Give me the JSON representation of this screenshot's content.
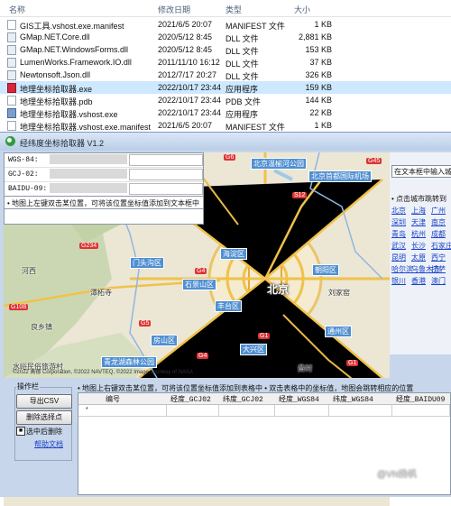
{
  "explorer": {
    "columns": {
      "name": "名称",
      "date": "修改日期",
      "type": "类型",
      "size": "大小"
    },
    "files": [
      {
        "name": "GIS工具.vshost.exe.manifest",
        "date": "2021/6/5 20:07",
        "type": "MANIFEST 文件",
        "size": "1 KB",
        "icon": "doc",
        "selected": false
      },
      {
        "name": "GMap.NET.Core.dll",
        "date": "2020/5/12 8:45",
        "type": "DLL 文件",
        "size": "2,881 KB",
        "icon": "dll",
        "selected": false
      },
      {
        "name": "GMap.NET.WindowsForms.dll",
        "date": "2020/5/12 8:45",
        "type": "DLL 文件",
        "size": "153 KB",
        "icon": "dll",
        "selected": false
      },
      {
        "name": "LumenWorks.Framework.IO.dll",
        "date": "2011/11/10 16:12",
        "type": "DLL 文件",
        "size": "37 KB",
        "icon": "dll",
        "selected": false
      },
      {
        "name": "Newtonsoft.Json.dll",
        "date": "2012/7/17 20:27",
        "type": "DLL 文件",
        "size": "326 KB",
        "icon": "dll",
        "selected": false
      },
      {
        "name": "地理坐标拾取器.exe",
        "date": "2022/10/17 23:44",
        "type": "应用程序",
        "size": "159 KB",
        "icon": "exe",
        "selected": true
      },
      {
        "name": "地理坐标拾取器.pdb",
        "date": "2022/10/17 23:44",
        "type": "PDB 文件",
        "size": "144 KB",
        "icon": "doc",
        "selected": false
      },
      {
        "name": "地理坐标拾取器.vshost.exe",
        "date": "2022/10/17 23:44",
        "type": "应用程序",
        "size": "22 KB",
        "icon": "exe2",
        "selected": false
      },
      {
        "name": "地理坐标拾取器.vshost.exe.manifest",
        "date": "2021/6/5 20:07",
        "type": "MANIFEST 文件",
        "size": "1 KB",
        "icon": "doc",
        "selected": false
      }
    ]
  },
  "app": {
    "title": "经纬度坐标拾取器 V1.2",
    "coords": [
      {
        "label": "WGS-84:"
      },
      {
        "label": "GCJ-02:"
      },
      {
        "label": "BAIDU-09:"
      }
    ],
    "map_hint": "• 地图上左键双击某位置，可将该位置坐标值添加到文本框中"
  },
  "map": {
    "center_label": "北京",
    "labels": [
      {
        "text": "北京温榆河公园",
        "style": "box"
      },
      {
        "text": "北京首都国际机场",
        "style": "box"
      },
      {
        "text": "门头沟区",
        "style": "box"
      },
      {
        "text": "海淀区",
        "style": "box"
      },
      {
        "text": "石景山区",
        "style": "box"
      },
      {
        "text": "朝阳区",
        "style": "box"
      },
      {
        "text": "丰台区",
        "style": "box"
      },
      {
        "text": "房山区",
        "style": "box"
      },
      {
        "text": "大兴区",
        "style": "box"
      },
      {
        "text": "通州区",
        "style": "box"
      },
      {
        "text": "青龙湖森林公园",
        "style": "box"
      },
      {
        "text": "水峪民俗旅游村",
        "style": "dark"
      },
      {
        "text": "潭柘寺",
        "style": "dark"
      },
      {
        "text": "河西",
        "style": "dark"
      },
      {
        "text": "良乡镇",
        "style": "dark"
      },
      {
        "text": "黄村",
        "style": "dark"
      },
      {
        "text": "刘家窑",
        "style": "dark"
      }
    ],
    "roads": [
      "G234",
      "G108",
      "G4",
      "G4",
      "G1",
      "G45",
      "G6",
      "S12",
      "G5",
      "G1"
    ],
    "copyright": "©2022 高德 Corporation, ©2022 NAVTEQ, ©2022 Image courtesy of NASA"
  },
  "right_panel": {
    "search_placeholder": "在文本框中输入城市",
    "city_hint": "• 点击城市跳转到",
    "cities": [
      "北京",
      "上海",
      "广州",
      "深圳",
      "天津",
      "南京",
      "青岛",
      "杭州",
      "成都",
      "武汉",
      "长沙",
      "石家庄",
      "昆明",
      "太原",
      "西宁",
      "哈尔滨",
      "乌鲁木齐",
      "拉萨",
      "银川",
      "香港",
      "澳门"
    ]
  },
  "ops": {
    "legend": "操作栏",
    "export_label": "导出CSV",
    "delete_label": "删除选择点",
    "checkbox_label": "选中后删除",
    "checkbox_mark": "■",
    "help_label": "帮助文档",
    "grid_hint": "• 地图上右键双击某位置，可将该位置坐标值添加到表格中  • 双击表格中的坐标值，地图会跳转相应的位置",
    "columns": [
      "编号",
      "经度_GCJ02",
      "纬度_GCJ02",
      "经度_WGS84",
      "纬度_WGS84",
      "经度_BAIDU09"
    ],
    "new_row_marker": "*"
  },
  "watermark": "@VN扬帆"
}
